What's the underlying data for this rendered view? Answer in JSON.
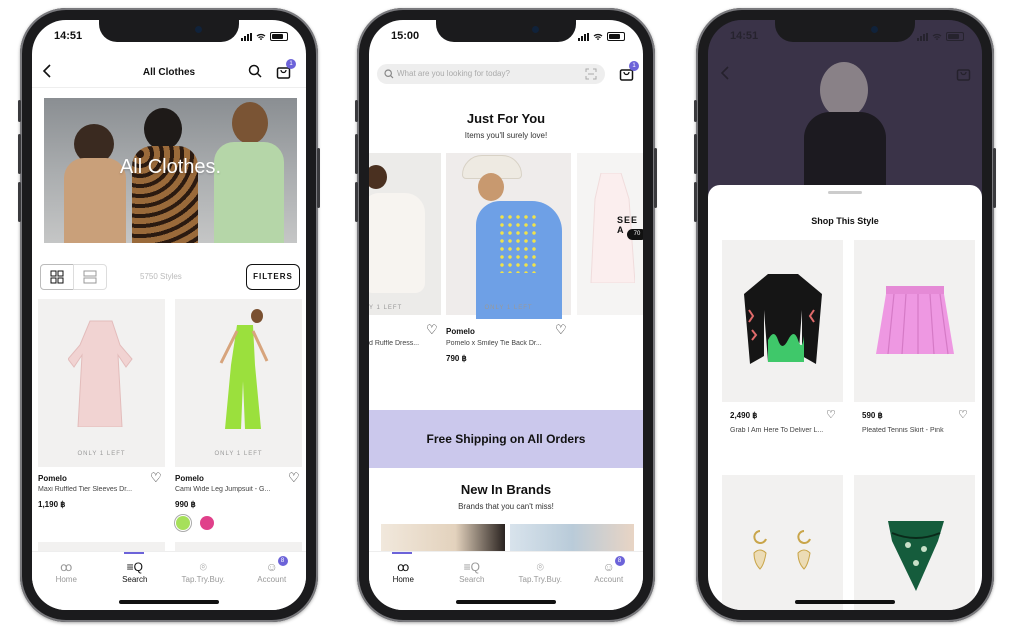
{
  "status_times": [
    "14:51",
    "15:00",
    "14:51"
  ],
  "s1": {
    "title": "All Clothes",
    "banner_text": "All Clothes.",
    "styles_count": "5750 Styles",
    "filters_label": "FILTERS",
    "cart_count": "1",
    "products": [
      {
        "only": "ONLY 1 LEFT",
        "brand": "Pomelo",
        "name": "Maxi Ruffled Tier Sleeves Dr...",
        "price": "1,190 ฿"
      },
      {
        "only": "ONLY 1 LEFT",
        "brand": "Pomelo",
        "name": "Cami Wide Leg Jumpsuit - G...",
        "price": "990 ฿",
        "swatches": [
          "#a6e05a",
          "#e0408a"
        ]
      }
    ]
  },
  "s2": {
    "search_placeholder": "What are you looking for today?",
    "cart_count": "1",
    "just_title": "Just For You",
    "just_sub": "Items you'll surely love!",
    "left_only": "Y 1 LEFT",
    "left_name": "d Ruffle Dress...",
    "only": "ONLY 1 LEFT",
    "brand": "Pomelo",
    "name": "Pomelo x Smiley Tie Back Dr...",
    "price": "790 ฿",
    "see_all": "SEE A",
    "see_count": "70",
    "shipping": "Free Shipping on All Orders",
    "new_title": "New In Brands",
    "new_sub": "Brands that you can't miss!"
  },
  "s3": {
    "sheet_title": "Shop This Style",
    "products": [
      {
        "price": "2,490 ฿",
        "name": "Grab I Am Here To Deliver L..."
      },
      {
        "price": "590 ฿",
        "name": "Pleated Tennis Skirt - Pink"
      }
    ]
  },
  "tabs": [
    "Home",
    "Search",
    "Tap.Try.Buy.",
    "Account"
  ],
  "account_badge": "8",
  "colors": {
    "accent": "#6c63d9",
    "shipping_bg": "#cbc8ec"
  }
}
